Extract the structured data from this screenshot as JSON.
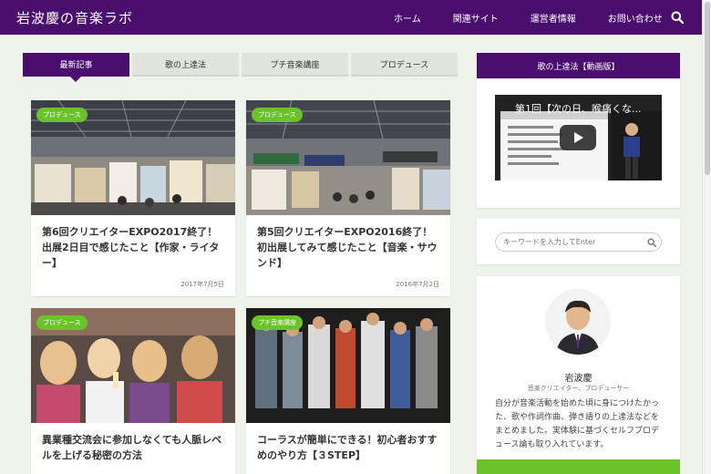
{
  "header": {
    "site_title": "岩波慶の音楽ラボ",
    "nav": [
      "ホーム",
      "関連サイト",
      "運営者情報",
      "お問い合わせ"
    ],
    "bg_color": "#4a0e6e"
  },
  "tabs": [
    "最新記事",
    "歌の上達法",
    "プチ音楽講座",
    "プロデュース"
  ],
  "articles": [
    {
      "category": "プロデュース",
      "title": "第6回クリエイターEXPO2017終了！出展2日目で感じたこと【作家・ライター】",
      "date": "2017年7月5日"
    },
    {
      "category": "プロデュース",
      "title": "第5回クリエイターEXPO2016終了！初出展してみて感じたこと【音楽・サウンド】",
      "date": "2016年7月2日"
    },
    {
      "category": "プロデュース",
      "title": "異業種交流会に参加しなくても人脈レベルを上げる秘密の方法",
      "date": ""
    },
    {
      "category": "プチ音楽講座",
      "title": "コーラスが簡単にできる！初心者おすすめのやり方【３STEP】",
      "date": ""
    }
  ],
  "sidebar": {
    "video_heading": "歌の上達法【動画版】",
    "video_title": "第1回【次の日、喉痛くな...",
    "search_placeholder": "キーワードを入力してEnter",
    "profile": {
      "name": "岩波慶",
      "role": "音楽クリエイター、プロデューサー",
      "bio": "自分が音楽活動を始めた頃に身につけたかった、歌や作詞作曲、弾き語りの上達法などをまとめました。実体験に基づくセルフプロデュース論も取り入れています。"
    }
  },
  "colors": {
    "accent": "#4a0e6e",
    "badge": "#6cc229"
  }
}
